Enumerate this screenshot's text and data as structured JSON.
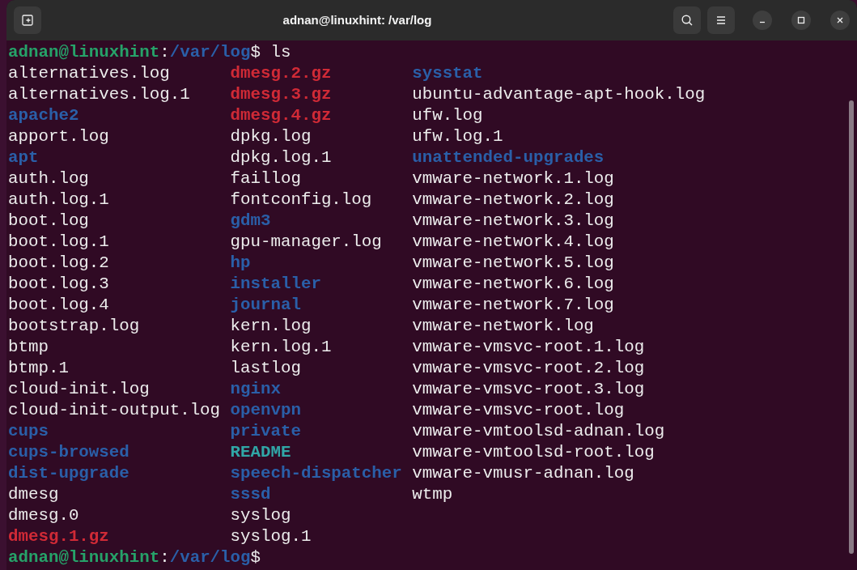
{
  "window": {
    "title": "adnan@linuxhint: /var/log"
  },
  "prompt": {
    "user_host": "adnan@linuxhint",
    "separator": ":",
    "path": "/var/log",
    "symbol": "$",
    "command": "ls"
  },
  "listing": [
    [
      {
        "name": "alternatives.log",
        "kind": "file"
      },
      {
        "name": "alternatives.log.1",
        "kind": "file"
      },
      {
        "name": "apache2",
        "kind": "dir"
      },
      {
        "name": "apport.log",
        "kind": "file"
      },
      {
        "name": "apt",
        "kind": "dir"
      },
      {
        "name": "auth.log",
        "kind": "file"
      },
      {
        "name": "auth.log.1",
        "kind": "file"
      },
      {
        "name": "boot.log",
        "kind": "file"
      },
      {
        "name": "boot.log.1",
        "kind": "file"
      },
      {
        "name": "boot.log.2",
        "kind": "file"
      },
      {
        "name": "boot.log.3",
        "kind": "file"
      },
      {
        "name": "boot.log.4",
        "kind": "file"
      },
      {
        "name": "bootstrap.log",
        "kind": "file"
      },
      {
        "name": "btmp",
        "kind": "file"
      },
      {
        "name": "btmp.1",
        "kind": "file"
      },
      {
        "name": "cloud-init.log",
        "kind": "file"
      },
      {
        "name": "cloud-init-output.log",
        "kind": "file"
      },
      {
        "name": "cups",
        "kind": "dir"
      },
      {
        "name": "cups-browsed",
        "kind": "dir"
      },
      {
        "name": "dist-upgrade",
        "kind": "dir"
      },
      {
        "name": "dmesg",
        "kind": "file"
      },
      {
        "name": "dmesg.0",
        "kind": "file"
      },
      {
        "name": "dmesg.1.gz",
        "kind": "archive"
      }
    ],
    [
      {
        "name": "dmesg.2.gz",
        "kind": "archive"
      },
      {
        "name": "dmesg.3.gz",
        "kind": "archive"
      },
      {
        "name": "dmesg.4.gz",
        "kind": "archive"
      },
      {
        "name": "dpkg.log",
        "kind": "file"
      },
      {
        "name": "dpkg.log.1",
        "kind": "file"
      },
      {
        "name": "faillog",
        "kind": "file"
      },
      {
        "name": "fontconfig.log",
        "kind": "file"
      },
      {
        "name": "gdm3",
        "kind": "dir"
      },
      {
        "name": "gpu-manager.log",
        "kind": "file"
      },
      {
        "name": "hp",
        "kind": "dir"
      },
      {
        "name": "installer",
        "kind": "dir"
      },
      {
        "name": "journal",
        "kind": "dir"
      },
      {
        "name": "kern.log",
        "kind": "file"
      },
      {
        "name": "kern.log.1",
        "kind": "file"
      },
      {
        "name": "lastlog",
        "kind": "file"
      },
      {
        "name": "nginx",
        "kind": "dir"
      },
      {
        "name": "openvpn",
        "kind": "dir"
      },
      {
        "name": "private",
        "kind": "dir"
      },
      {
        "name": "README",
        "kind": "link"
      },
      {
        "name": "speech-dispatcher",
        "kind": "dir"
      },
      {
        "name": "sssd",
        "kind": "dir"
      },
      {
        "name": "syslog",
        "kind": "file"
      },
      {
        "name": "syslog.1",
        "kind": "file"
      }
    ],
    [
      {
        "name": "sysstat",
        "kind": "dir"
      },
      {
        "name": "ubuntu-advantage-apt-hook.log",
        "kind": "file"
      },
      {
        "name": "ufw.log",
        "kind": "file"
      },
      {
        "name": "ufw.log.1",
        "kind": "file"
      },
      {
        "name": "unattended-upgrades",
        "kind": "dir"
      },
      {
        "name": "vmware-network.1.log",
        "kind": "file"
      },
      {
        "name": "vmware-network.2.log",
        "kind": "file"
      },
      {
        "name": "vmware-network.3.log",
        "kind": "file"
      },
      {
        "name": "vmware-network.4.log",
        "kind": "file"
      },
      {
        "name": "vmware-network.5.log",
        "kind": "file"
      },
      {
        "name": "vmware-network.6.log",
        "kind": "file"
      },
      {
        "name": "vmware-network.7.log",
        "kind": "file"
      },
      {
        "name": "vmware-network.log",
        "kind": "file"
      },
      {
        "name": "vmware-vmsvc-root.1.log",
        "kind": "file"
      },
      {
        "name": "vmware-vmsvc-root.2.log",
        "kind": "file"
      },
      {
        "name": "vmware-vmsvc-root.3.log",
        "kind": "file"
      },
      {
        "name": "vmware-vmsvc-root.log",
        "kind": "file"
      },
      {
        "name": "vmware-vmtoolsd-adnan.log",
        "kind": "file"
      },
      {
        "name": "vmware-vmtoolsd-root.log",
        "kind": "file"
      },
      {
        "name": "vmware-vmusr-adnan.log",
        "kind": "file"
      },
      {
        "name": "wtmp",
        "kind": "file"
      }
    ]
  ],
  "final_prompt": {
    "user_host": "adnan@linuxhint",
    "separator": ":",
    "path": "/var/log",
    "symbol": "$"
  }
}
